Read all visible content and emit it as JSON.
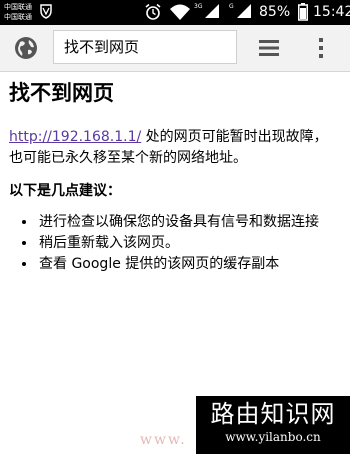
{
  "status_bar": {
    "carrier_1": "中国联通",
    "carrier_2": "中国联通",
    "network_1": "3G",
    "network_2": "G",
    "battery": "85%",
    "time": "15:42"
  },
  "toolbar": {
    "url_text": "找不到网页"
  },
  "page": {
    "title": "找不到网页",
    "link_text": "http://192.168.1.1/",
    "description": " 处的网页可能暂时出现故障，也可能已永久移至某个新的网络地址。",
    "suggestions_heading": "以下是几点建议：",
    "suggestions": [
      "进行检查以确保您的设备具有信号和数据连接",
      "稍后重新载入该网页。",
      "查看 Google 提供的该网页的缓存副本"
    ]
  },
  "watermark": {
    "title": "路由知识网",
    "url": "www.yilanbo.cn",
    "faint": "www."
  }
}
